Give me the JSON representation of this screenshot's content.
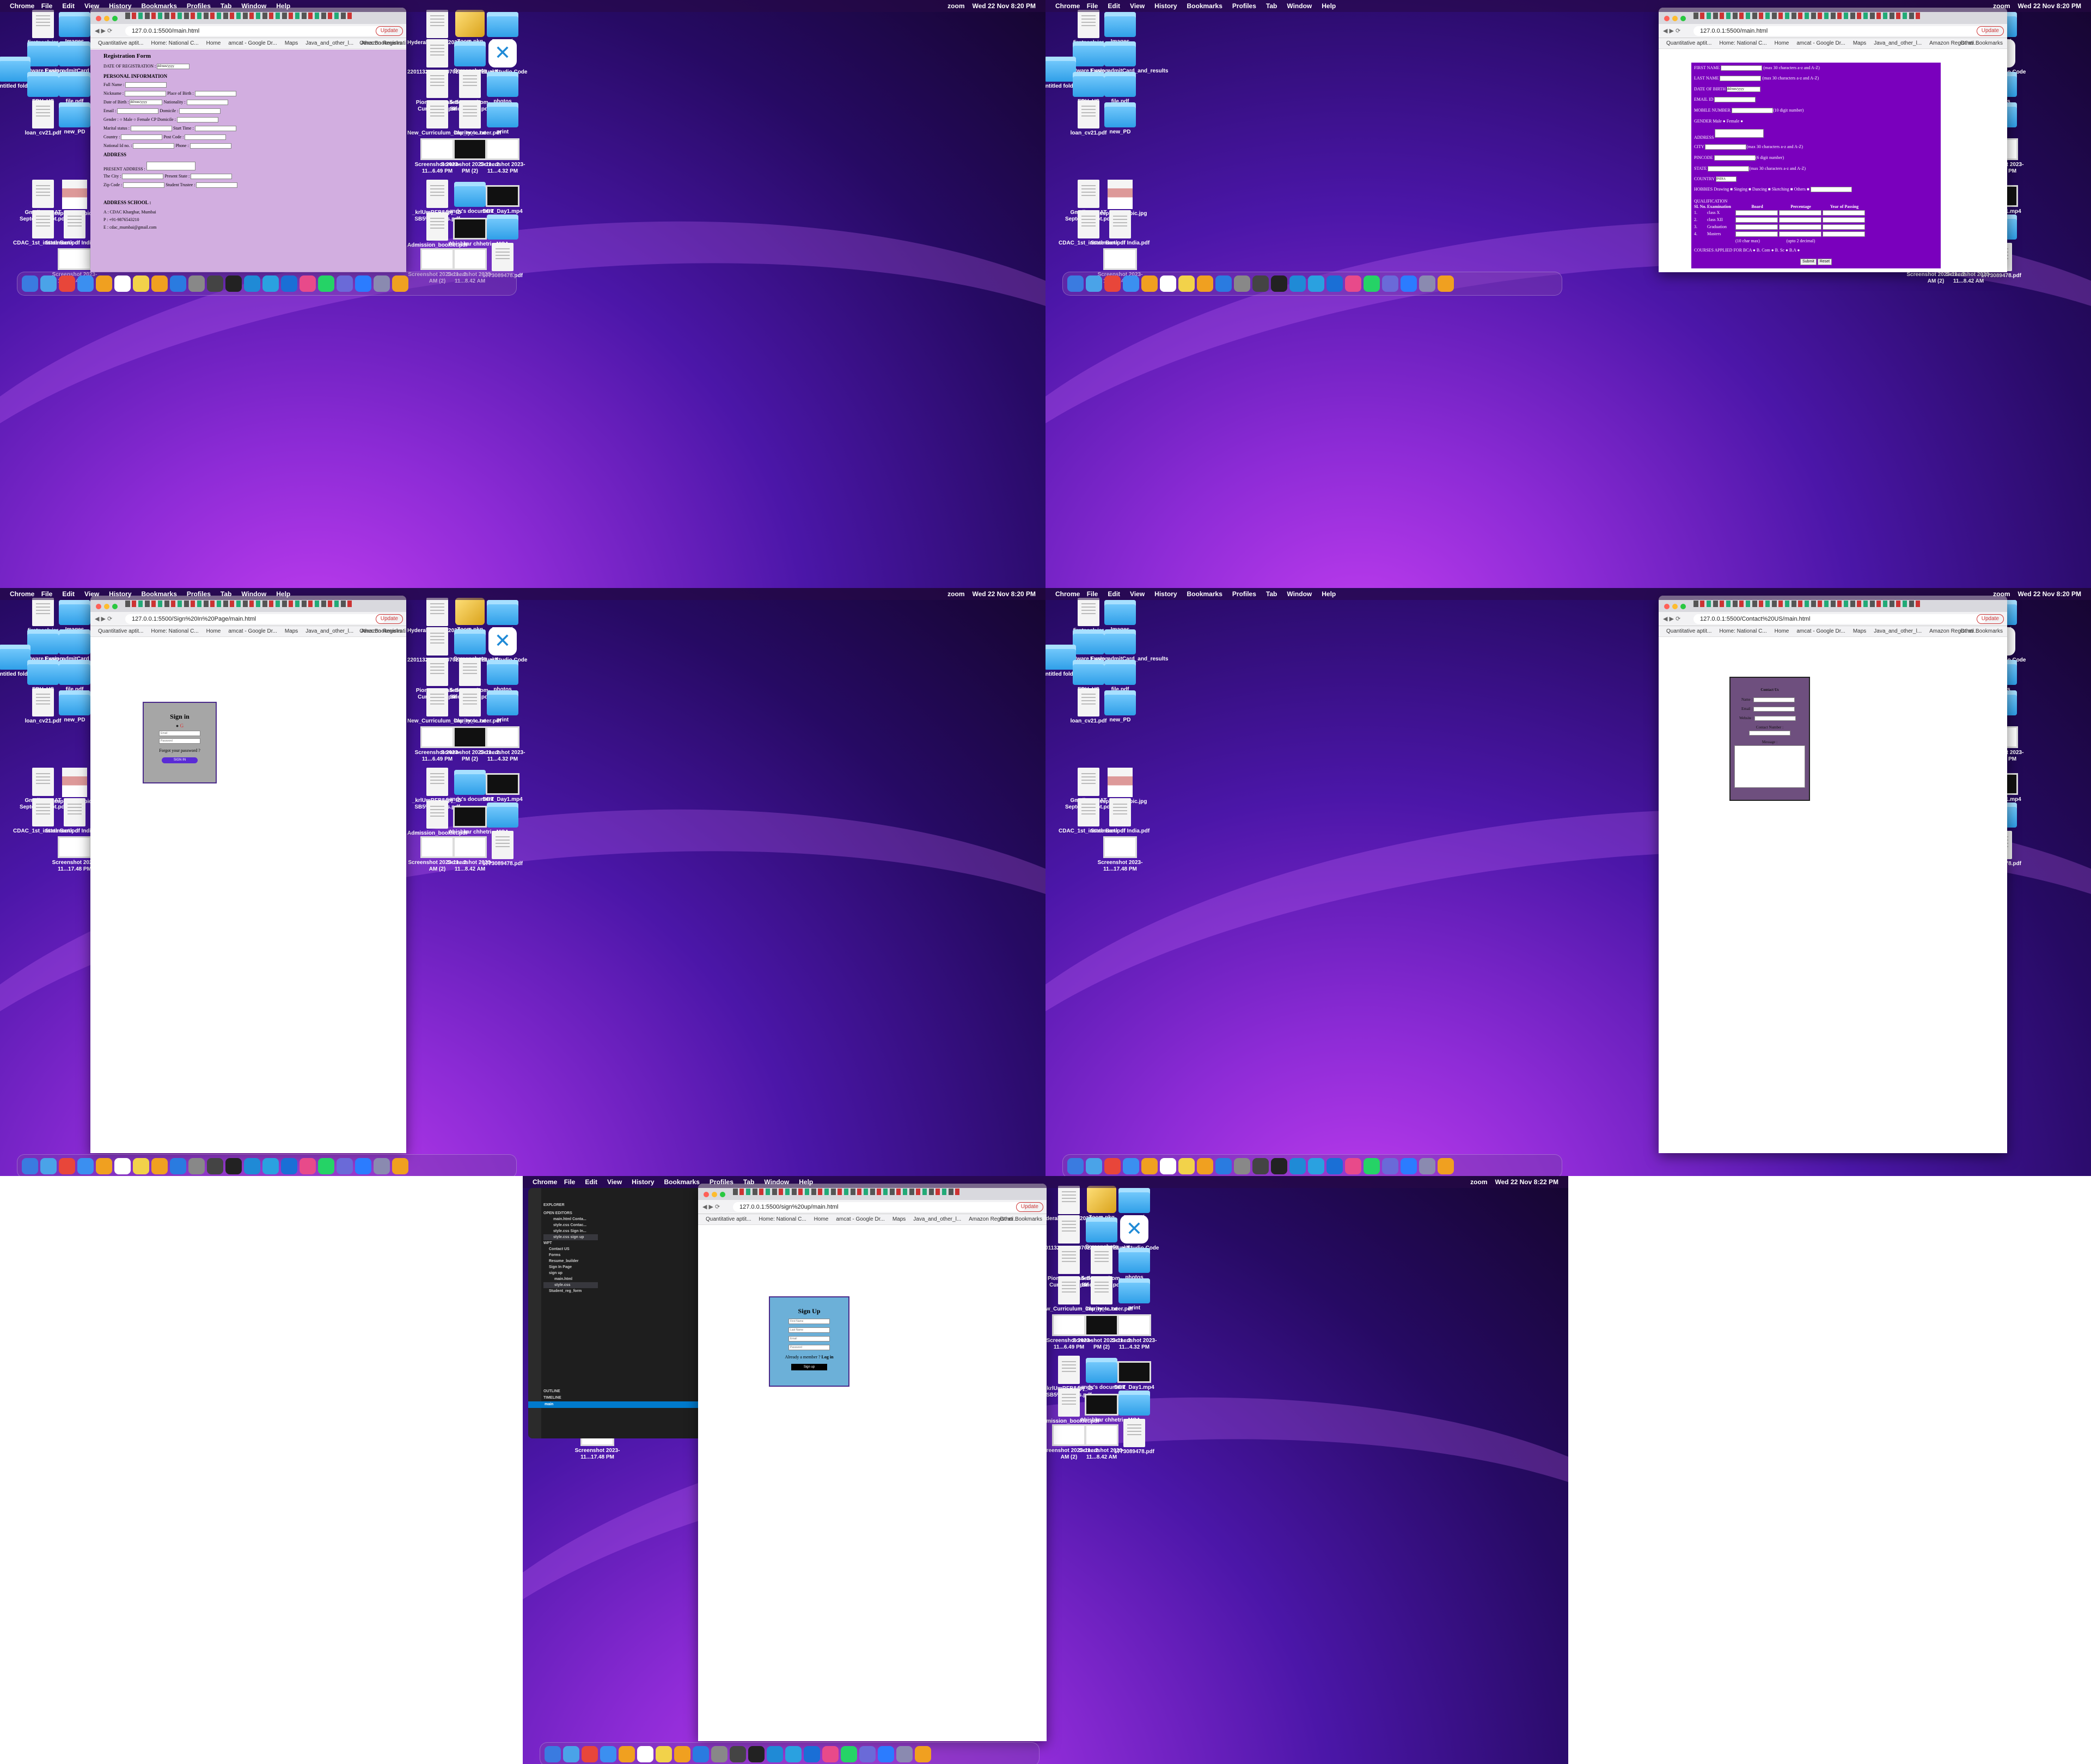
{
  "menubar": {
    "app": "Chrome",
    "items": [
      "File",
      "Edit",
      "View",
      "History",
      "Bookmarks",
      "Profiles",
      "Tab",
      "Window",
      "Help"
    ],
    "zoom": "zoom",
    "time": "Wed 22 Nov 8:20 PM",
    "time_last": "Wed 22 Nov 8:22 PM"
  },
  "browser": {
    "url_registration": "127.0.0.1:5500/main.html",
    "url_form": "127.0.0.1:5500/main.html",
    "url_signin": "127.0.0.1:5500/Sign%20In%20Page/main.html",
    "url_contact": "127.0.0.1:5500/Contact%20US/main.html",
    "url_signup": "127.0.0.1:5500/sign%20up/main.html",
    "update": "Update",
    "bookmarks": [
      "Quantitative aptit...",
      "Home: National C...",
      "Home",
      "amcat - Google Dr...",
      "Maps",
      "Java_and_other_l...",
      "Amazon Registrati..."
    ],
    "other_bookmarks": "Other Bookmarks"
  },
  "desktop": {
    "left": [
      {
        "label": "firstpack.jar",
        "type": "doc"
      },
      {
        "label": "Images",
        "type": "folder"
      },
      {
        "label": "VMware Fusion",
        "type": "folder"
      },
      {
        "label": "Exam_admitCard_and_results",
        "type": "folder"
      },
      {
        "label": "untitled folder",
        "type": "folder"
      },
      {
        "label": "EDV_US",
        "type": "folder"
      },
      {
        "label": "file.pdf",
        "type": "folder"
      },
      {
        "label": "loan_cv21.pdf",
        "type": "doc"
      },
      {
        "label": "new_PD",
        "type": "folder"
      },
      {
        "label": "Gmail - C-CAT Septem...ceipt.pdf",
        "type": "doc"
      },
      {
        "label": "passport size pic.jpg",
        "type": "photo"
      },
      {
        "label": "CDAC_1st_instalment.pdf",
        "type": "doc"
      },
      {
        "label": "State Bank of India.pdf",
        "type": "doc"
      },
      {
        "label": "Screenshot 2023-11...17.48 PM",
        "type": "shot"
      }
    ],
    "right": [
      {
        "label": "Hyderabad_LL_2023.pdf",
        "type": "doc"
      },
      {
        "label": "Zoom.pkg",
        "type": "pkg"
      },
      {
        "label": "Resumé",
        "type": "folder"
      },
      {
        "label": "2201132772_2207022232...30E1.pdf",
        "type": "doc"
      },
      {
        "label": "Screenshots",
        "type": "folder"
      },
      {
        "label": "Visual Studio Code",
        "type": "vsc"
      },
      {
        "label": "Pioneer Detailed Curriculum.pdf",
        "type": "doc"
      },
      {
        "label": "5-Secrets-from-BridgeLabz.pdf",
        "type": "doc"
      },
      {
        "label": "photos",
        "type": "folder"
      },
      {
        "label": "New_Curriculum_Clarity_-...neer.pdf",
        "type": "doc"
      },
      {
        "label": "imp_note.txt",
        "type": "doc"
      },
      {
        "label": "print",
        "type": "folder"
      },
      {
        "label": "Screenshot 2023-11...6.49 PM",
        "type": "shot"
      },
      {
        "label": "Screenshot 2023-11...2 PM (2)",
        "type": "shotdark"
      },
      {
        "label": "Screenshot 2023-11...4.32 PM",
        "type": "shot"
      },
      {
        "label": "_krlUmRFB84pj_lZ-SB5%2...lines.pdf",
        "type": "doc"
      },
      {
        "label": "sandy's document",
        "type": "folder"
      },
      {
        "label": "DBT_Day1.mp4",
        "type": "shotdark"
      },
      {
        "label": "Admission_booklet.pdf",
        "type": "doc"
      },
      {
        "label": "Abishkar chhetri",
        "type": "shotdark"
      },
      {
        "label": "MCA",
        "type": "folder"
      },
      {
        "label": "Screenshot 2023-11...2 AM (2)",
        "type": "shot"
      },
      {
        "label": "Screenshot 2023-11...8.42 AM",
        "type": "shot"
      },
      {
        "label": "1773089478.pdf",
        "type": "doc"
      }
    ]
  },
  "registration": {
    "title": "Registration Form",
    "date_reg_label": "DATE OF REGISTRATION :",
    "date_placeholder": "dd/mm/yyyy",
    "personal": "PERSONAL INFORMATION",
    "full_name": "Full Name :",
    "nickname": "Nickname :",
    "place_birth": "Place of Birth :",
    "dob": "Date of Birth :",
    "nationality": "Nationality :",
    "email": "Email :",
    "domicile": "Domicile :",
    "gender": "Gender :",
    "male": "Male",
    "female": "Female",
    "cp_domicile": "CP Domicile :",
    "marital": "Marital status :",
    "start_time": "Start Time :",
    "country": "Country :",
    "post_code": "Post Code :",
    "national_id": "National Id no. :",
    "phone": "Phone :",
    "address_head": "ADDRESS",
    "present_address": "PRESENT ADDRESS :",
    "city": "The City :",
    "present_state": "Present State :",
    "zip": "Zip Code :",
    "student_trustee": "Student Trustee :",
    "school_head": "ADDRESS SCHOOL :",
    "school_a": "A : CDAC Kharghar, Mumbai",
    "school_p": "P : +91-9876543210",
    "school_e": "E : cdac_mumbai@gmail.com"
  },
  "form": {
    "first_name": "FIRST NAME",
    "first_hint": "(max 30 characters a-z and A-Z)",
    "last_name": "LAST NAME",
    "last_hint": "(max 30 characters a-z and A-Z)",
    "dob": "DATE OF BIRTH",
    "dob_ph": "dd/mm/yyyy",
    "email": "EMAIL ID",
    "mobile": "MOBILE NUMBER",
    "mobile_hint": "(10 digit number)",
    "gender": "GENDER Male",
    "female": "Female",
    "address": "ADDRESS",
    "city": "CITY",
    "city_hint": "(max 30 characters a-z and A-Z)",
    "pincode": "PINCODE",
    "pin_hint": "(6 digit number)",
    "state": "STATE",
    "state_hint": "(max 30 characters a-z and A-Z)",
    "country": "COUNTRY",
    "country_val": "INDIA",
    "hobbies": "HOBBIES Drawing",
    "singing": "Singing",
    "dancing": "Dancing",
    "sketching": "Sketching",
    "others": "Others",
    "qualification": "QUALIFICATION",
    "q_headers": [
      "Sl. No.",
      "Examination",
      "Board",
      "Percentage",
      "Year of Passing"
    ],
    "q_rows": [
      {
        "n": "1.",
        "exam": "class X"
      },
      {
        "n": "2.",
        "exam": "class XII"
      },
      {
        "n": "3.",
        "exam": "Graduation"
      },
      {
        "n": "4.",
        "exam": "Masters"
      }
    ],
    "char_max": "(10 char max)",
    "decimal": "(upto 2 decimal)",
    "courses": "COURSES APPLIED FOR BCA",
    "bcom": "B. Com",
    "bsc": "B. Sc",
    "ba": "B.A",
    "submit": "Submit",
    "reset": "Reset"
  },
  "signin": {
    "title": "Sign in",
    "email_ph": "Email",
    "password_ph": "Password",
    "forgot": "Forgot your password ?",
    "button": "SIGN IN"
  },
  "contact": {
    "title": "Contact Us",
    "name": "Name :",
    "email": "Email :",
    "website": "Website :",
    "contact_number": "Contact Number :",
    "message": "Message :"
  },
  "signup": {
    "title": "Sign Up",
    "first_ph": "First Name",
    "last_ph": "Last Name",
    "email_ph": "Email",
    "password_ph": "Password",
    "member": "Already a member ?",
    "login": "Log in",
    "button": "Sign up"
  },
  "vscode": {
    "explorer": "EXPLORER",
    "open_editors": "OPEN EDITORS",
    "files": [
      "main.html Conta...",
      "style.css Contac...",
      "style.css Sign In...",
      "style.css sign up"
    ],
    "project": "WPT",
    "tree": [
      "Contact US",
      "Forms",
      "Resume_builder",
      "Sign In Page",
      "sign up",
      "main.html",
      "style.css",
      "Student_reg_form"
    ],
    "outline": "OUTLINE",
    "timeline": "TIMELINE",
    "branch": "main"
  },
  "colors": {
    "registration_bg": "#d2aee0",
    "form_bg": "#7a00bd",
    "signin_bg": "#a6a6a6",
    "contact_bg": "#6e4f7e",
    "signup_bg": "#6cb0d8",
    "signin_btn": "#5a2bd6"
  }
}
